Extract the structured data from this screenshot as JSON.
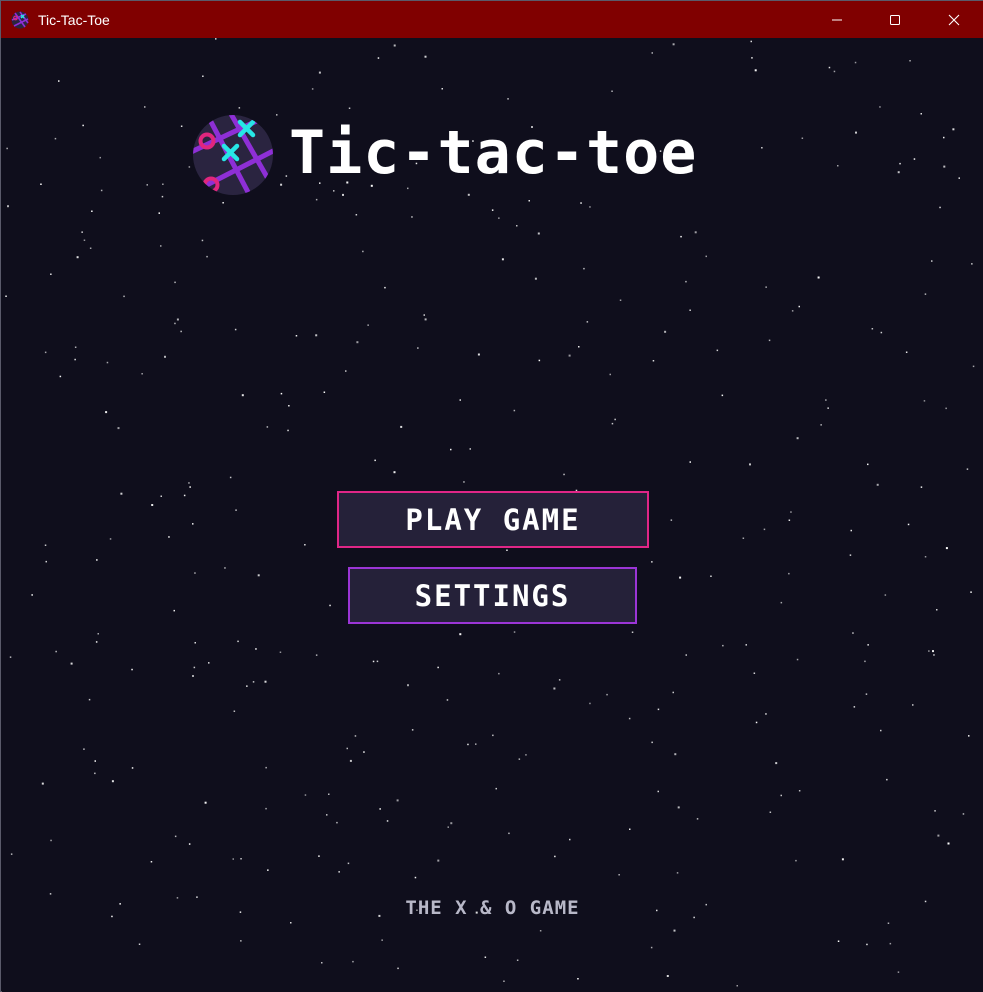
{
  "window": {
    "title": "Tic-Tac-Toe",
    "title_bar_color": "#800000",
    "controls": {
      "minimize": "minimize-icon",
      "maximize": "maximize-icon",
      "close": "close-icon"
    }
  },
  "game": {
    "title": "Tic-tac-toe",
    "logo": "tic-tac-toe-logo-icon",
    "menu": {
      "play_label": "PLAY GAME",
      "settings_label": "SETTINGS"
    },
    "footer": "THE X & O GAME"
  },
  "colors": {
    "background": "#0f0e1c",
    "button_fill": "#252139",
    "play_border": "#e02687",
    "settings_border": "#9b35d6",
    "logo_x": "#27e6e6",
    "logo_o": "#e0267e",
    "logo_grid": "#8e2fd6"
  }
}
